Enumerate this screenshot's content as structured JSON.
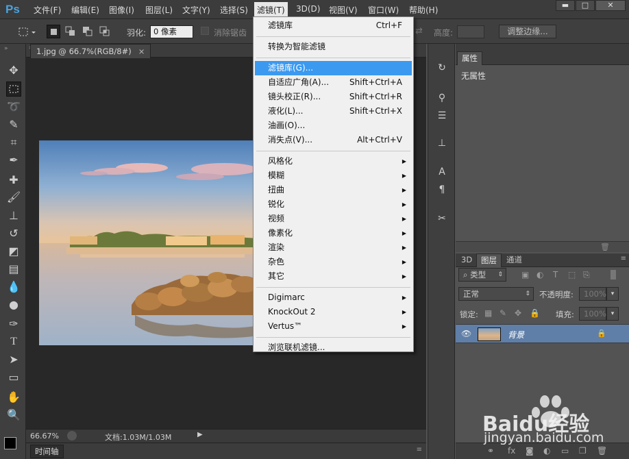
{
  "app": {
    "logo": "Ps"
  },
  "menubar": {
    "items": [
      "文件(F)",
      "编辑(E)",
      "图像(I)",
      "图层(L)",
      "文字(Y)",
      "选择(S)",
      "滤镜(T)",
      "3D(D)",
      "视图(V)",
      "窗口(W)",
      "帮助(H)"
    ],
    "active_index": 6
  },
  "options": {
    "feather_label": "羽化:",
    "feather_value": "0 像素",
    "antialias_label": "消除锯齿",
    "height_label": "高度:",
    "refine_edge_button": "调整边缘..."
  },
  "document": {
    "tab_title": "1.jpg @ 66.7%(RGB/8#)",
    "zoom": "66.67%",
    "doc_size": "文档:1.03M/1.03M"
  },
  "timeline": {
    "label": "时间轴"
  },
  "properties_panel": {
    "title": "属性",
    "empty_text": "无属性"
  },
  "layers_panel": {
    "tabs": [
      "3D",
      "图层",
      "通道"
    ],
    "active_tab": 1,
    "filter_kind": "类型",
    "blend_mode": "正常",
    "opacity_label": "不透明度:",
    "opacity_value": "100%",
    "lock_label": "锁定:",
    "fill_label": "填充:",
    "fill_value": "100%",
    "layers": [
      {
        "name": "背景",
        "locked": true,
        "visible": true
      }
    ]
  },
  "filter_menu": {
    "items": [
      {
        "label": "滤镜库",
        "shortcut": "Ctrl+F"
      },
      {
        "sep": true
      },
      {
        "label": "转换为智能滤镜"
      },
      {
        "sep": true
      },
      {
        "label": "滤镜库(G)...",
        "highlighted": true
      },
      {
        "label": "自适应广角(A)...",
        "shortcut": "Shift+Ctrl+A"
      },
      {
        "label": "镜头校正(R)...",
        "shortcut": "Shift+Ctrl+R"
      },
      {
        "label": "液化(L)...",
        "shortcut": "Shift+Ctrl+X"
      },
      {
        "label": "油画(O)..."
      },
      {
        "label": "消失点(V)...",
        "shortcut": "Alt+Ctrl+V"
      },
      {
        "sep": true
      },
      {
        "label": "风格化",
        "submenu": true
      },
      {
        "label": "模糊",
        "submenu": true
      },
      {
        "label": "扭曲",
        "submenu": true
      },
      {
        "label": "锐化",
        "submenu": true
      },
      {
        "label": "视频",
        "submenu": true
      },
      {
        "label": "像素化",
        "submenu": true
      },
      {
        "label": "渲染",
        "submenu": true
      },
      {
        "label": "杂色",
        "submenu": true
      },
      {
        "label": "其它",
        "submenu": true
      },
      {
        "sep": true
      },
      {
        "label": "Digimarc",
        "submenu": true
      },
      {
        "label": "KnockOut 2",
        "submenu": true
      },
      {
        "label": "Vertus™",
        "submenu": true
      },
      {
        "sep": true
      },
      {
        "label": "浏览联机滤镜..."
      }
    ]
  },
  "watermark": {
    "brand": "Baidu经验",
    "url": "jingyan.baidu.com"
  },
  "colors": {
    "accent": "#3b99f0",
    "logo": "#4aa3df",
    "ui_dark": "#3c3c3c"
  }
}
